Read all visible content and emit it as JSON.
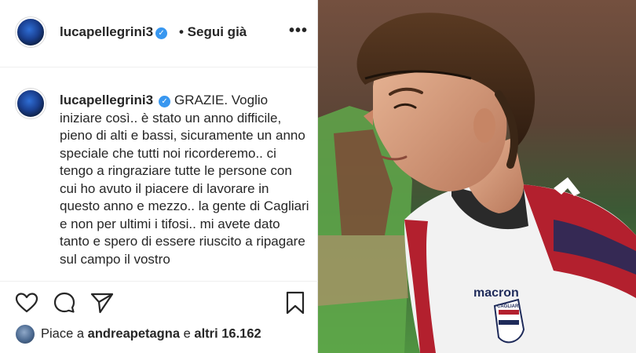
{
  "header": {
    "username": "lucapellegrini3",
    "follow_label": "• Segui già",
    "more_label": "•••"
  },
  "caption": {
    "username": "lucapellegrini3",
    "text": "GRAZIE. Voglio iniziare così.. è stato un anno difficile, pieno di alti e bassi, sicuramente un anno speciale che tutti noi ricorderemo.. ci tengo a ringraziare tutte le persone con cui ho avuto il piacere di lavorare in questo anno e mezzo.. la gente di Cagliari e non per ultimi i tifosi.. mi avete dato tanto e spero di essere riuscito a ripagare sul campo il vostro"
  },
  "likes": {
    "prefix": "Piace a",
    "user": "andreapetagna",
    "middle": "e",
    "others": "altri 16.162"
  },
  "icons": {
    "like": "heart-icon",
    "comment": "comment-icon",
    "share": "send-icon",
    "save": "bookmark-icon",
    "verified": "verified-badge-icon"
  },
  "photo": {
    "jersey_brand": "macron",
    "crest_text": "CAGLIARI"
  },
  "colors": {
    "verified": "#3897f0",
    "jersey_red": "#b3202e",
    "jersey_white": "#f2f2f2",
    "pitch_green": "#4c9a3e"
  }
}
